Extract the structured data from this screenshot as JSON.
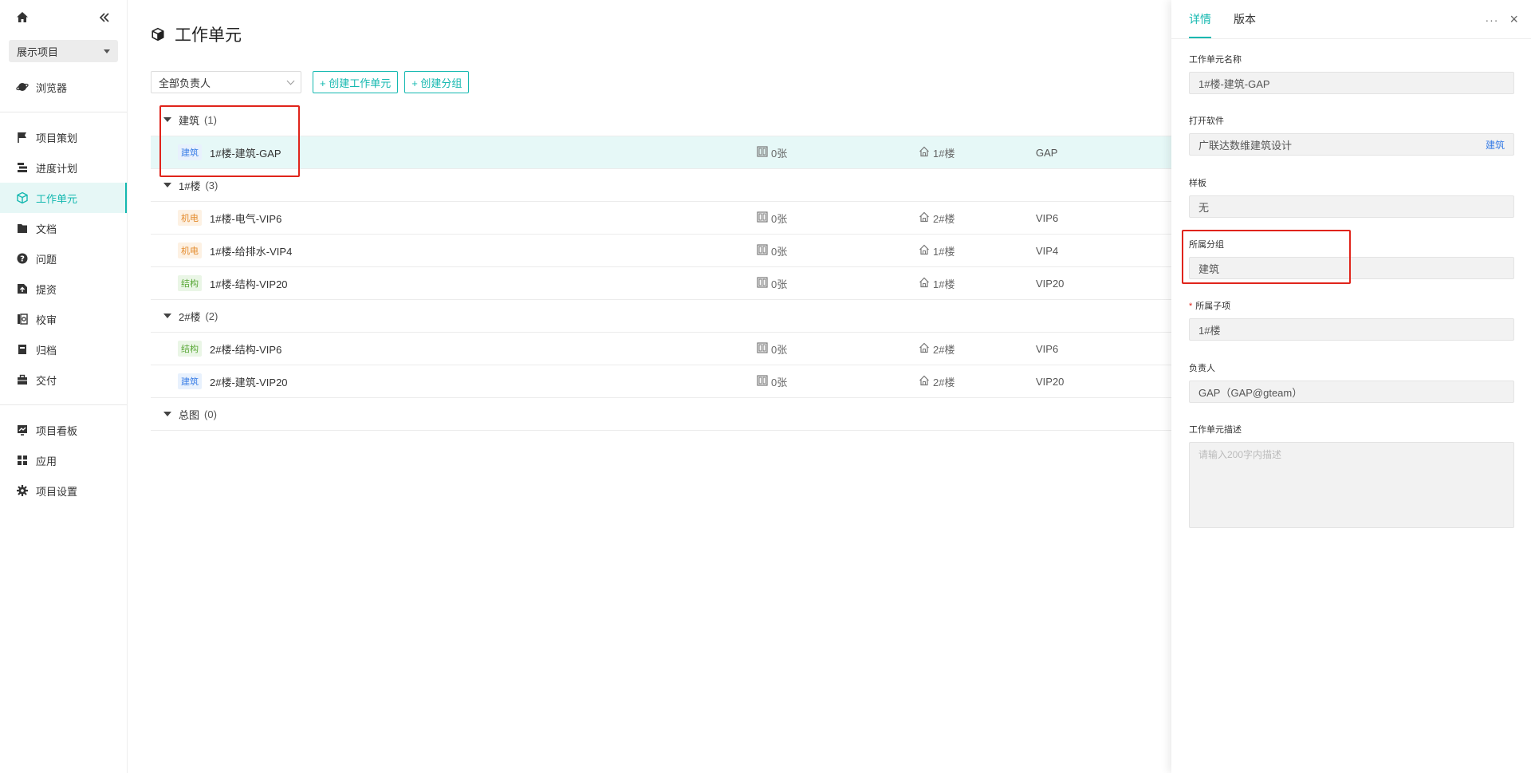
{
  "sidebar": {
    "project": "展示项目",
    "items": [
      {
        "label": "浏览器",
        "icon": "planet-icon"
      },
      {
        "label": "项目策划",
        "icon": "flag-icon"
      },
      {
        "label": "进度计划",
        "icon": "gantt-icon"
      },
      {
        "label": "工作单元",
        "icon": "cube-icon",
        "active": true
      },
      {
        "label": "文档",
        "icon": "folder-icon"
      },
      {
        "label": "问题",
        "icon": "question-icon"
      },
      {
        "label": "提资",
        "icon": "upload-doc-icon"
      },
      {
        "label": "校审",
        "icon": "review-icon"
      },
      {
        "label": "归档",
        "icon": "archive-icon"
      },
      {
        "label": "交付",
        "icon": "briefcase-icon"
      },
      {
        "label": "项目看板",
        "icon": "dashboard-icon"
      },
      {
        "label": "应用",
        "icon": "apps-icon"
      },
      {
        "label": "项目设置",
        "icon": "gear-icon"
      }
    ]
  },
  "main": {
    "title": "工作单元",
    "owner_filter": "全部负责人",
    "create_unit_btn": "+ 创建工作单元",
    "create_group_btn": "+ 创建分组",
    "groups": [
      {
        "name": "建筑",
        "count": "(1)",
        "rows": [
          {
            "tag": "建筑",
            "tag_color": "blue",
            "name": "1#楼-建筑-GAP",
            "pages": "0张",
            "floor": "1#楼",
            "owner": "GAP",
            "selected": true
          }
        ]
      },
      {
        "name": "1#楼",
        "count": "(3)",
        "rows": [
          {
            "tag": "机电",
            "tag_color": "orange",
            "name": "1#楼-电气-VIP6",
            "pages": "0张",
            "floor": "2#楼",
            "owner": "VIP6"
          },
          {
            "tag": "机电",
            "tag_color": "orange",
            "name": "1#楼-给排水-VIP4",
            "pages": "0张",
            "floor": "1#楼",
            "owner": "VIP4"
          },
          {
            "tag": "结构",
            "tag_color": "green",
            "name": "1#楼-结构-VIP20",
            "pages": "0张",
            "floor": "1#楼",
            "owner": "VIP20"
          }
        ]
      },
      {
        "name": "2#楼",
        "count": "(2)",
        "rows": [
          {
            "tag": "结构",
            "tag_color": "green",
            "name": "2#楼-结构-VIP6",
            "pages": "0张",
            "floor": "2#楼",
            "owner": "VIP6"
          },
          {
            "tag": "建筑",
            "tag_color": "blue",
            "name": "2#楼-建筑-VIP20",
            "pages": "0张",
            "floor": "2#楼",
            "owner": "VIP20"
          }
        ]
      },
      {
        "name": "总图",
        "count": "(0)",
        "rows": []
      }
    ]
  },
  "panel": {
    "tab_detail": "详情",
    "tab_version": "版本",
    "more": "···",
    "close": "×",
    "unit_name_label": "工作单元名称",
    "unit_name_value": "1#楼-建筑-GAP",
    "software_label": "打开软件",
    "software_value": "广联达数维建筑设计",
    "software_tag": "建筑",
    "template_label": "样板",
    "template_value": "无",
    "group_label": "所属分组",
    "group_value": "建筑",
    "subitem_required": "*",
    "subitem_label": "所属子项",
    "subitem_value": "1#楼",
    "owner_label": "负责人",
    "owner_value": "GAP（GAP@gteam）",
    "desc_label": "工作单元描述",
    "desc_placeholder": "请输入200字内描述"
  },
  "colors": {
    "accent": "#14b8b0",
    "highlight_box": "#e0241b",
    "tag_blue": "#3a7ee6",
    "tag_orange": "#e38a2b",
    "tag_green": "#5aa838"
  }
}
